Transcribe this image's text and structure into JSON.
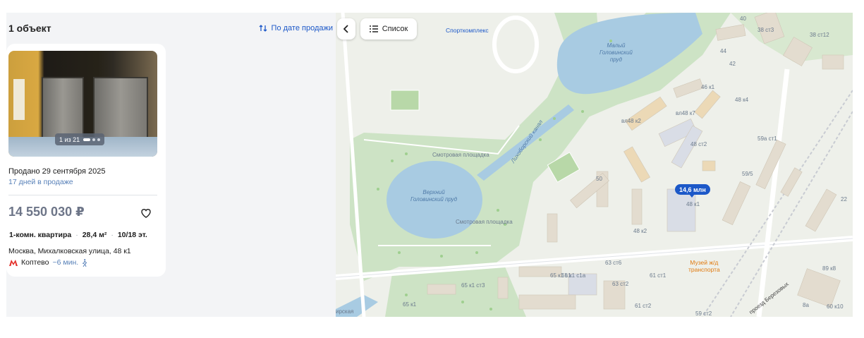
{
  "results": {
    "count_label": "1 объект",
    "sort_label": "По дате продажи"
  },
  "listing": {
    "photo_counter": "1 из 21",
    "sold_date": "Продано 29 сентября 2025",
    "days_on_sale": "17 дней в продаже",
    "price": "14 550 030 ₽",
    "rooms": "1-комн. квартира",
    "area": "28,4 м²",
    "floor": "10/18 эт.",
    "address": "Москва, Михалковская улица, 48 к1",
    "metro_station": "Коптево",
    "metro_walk": "~6 мин.",
    "metro_color": "#e4312b"
  },
  "map": {
    "list_button": "Список",
    "price_pin": "14,6 млн",
    "labels": {
      "sport": "Спорткомплекс",
      "small_pond": "Малый\nГоловинский\nпруд",
      "big_pond": "Верхний\nГоловинский пруд",
      "canal": "Лихоборский канал",
      "viewpoint_top": "Смотровая площадка",
      "viewpoint_bottom": "Смотровая площадка",
      "museum": "Музей ж/д\nтранспорта",
      "street": "проезд Березовых",
      "street_left": "ирская"
    },
    "building_numbers": [
      "40",
      "38 ст3",
      "38 ст12",
      "44",
      "42",
      "46 к1",
      "48 к4",
      "вл48 к7",
      "вл48 к2",
      "48 ст2",
      "59а ст1",
      "59/5",
      "50",
      "48 к1",
      "48 к2",
      "22",
      "63 ст6",
      "63 ст2",
      "61 ст1",
      "61 ст2",
      "65 к1 с1",
      "65 к1 с1а",
      "65 к1",
      "65 к1 ст3",
      "89 к8",
      "8а",
      "60 к10",
      "59 ст2"
    ]
  }
}
